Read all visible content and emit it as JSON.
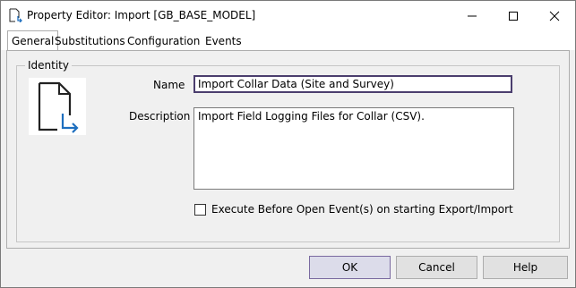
{
  "window": {
    "title": "Property Editor: Import [GB_BASE_MODEL]",
    "icon": "document-import-icon",
    "controls": {
      "minimize": "minimize-icon",
      "maximize": "maximize-icon",
      "close": "close-icon"
    }
  },
  "tabs": [
    {
      "label": "General",
      "active": true
    },
    {
      "label": "Substitutions",
      "active": false
    },
    {
      "label": "Configuration",
      "active": false
    },
    {
      "label": "Events",
      "active": false
    }
  ],
  "identity": {
    "group_label": "Identity",
    "icon": "document-import-icon",
    "name_label": "Name",
    "name_value": "Import Collar Data (Site and Survey)",
    "description_label": "Description",
    "description_value": "Import Field Logging Files for Collar (CSV).",
    "checkbox_label": "Execute Before Open Event(s) on starting Export/Import",
    "checkbox_checked": false
  },
  "buttons": {
    "ok": "OK",
    "cancel": "Cancel",
    "help": "Help"
  },
  "colors": {
    "accent": "#1e6fbf",
    "focus_border": "#4b3e6e"
  }
}
